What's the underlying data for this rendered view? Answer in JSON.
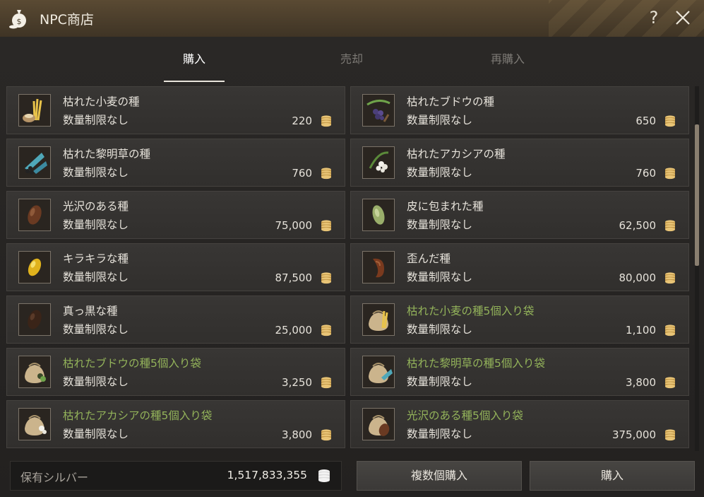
{
  "window": {
    "title": "NPC商店"
  },
  "tabs": [
    {
      "label": "購入",
      "active": true
    },
    {
      "label": "売却",
      "active": false
    },
    {
      "label": "再購入",
      "active": false
    }
  ],
  "items": [
    {
      "name": "枯れた小麦の種",
      "limit": "数量制限なし",
      "price": "220",
      "bundle": false,
      "icon": "wheat-seed-icon"
    },
    {
      "name": "枯れたブドウの種",
      "limit": "数量制限なし",
      "price": "650",
      "bundle": false,
      "icon": "grape-seed-icon"
    },
    {
      "name": "枯れた黎明草の種",
      "limit": "数量制限なし",
      "price": "760",
      "bundle": false,
      "icon": "dawn-grass-seed-icon"
    },
    {
      "name": "枯れたアカシアの種",
      "limit": "数量制限なし",
      "price": "760",
      "bundle": false,
      "icon": "acacia-seed-icon"
    },
    {
      "name": "光沢のある種",
      "limit": "数量制限なし",
      "price": "75,000",
      "bundle": false,
      "icon": "glossy-seed-icon"
    },
    {
      "name": "皮に包まれた種",
      "limit": "数量制限なし",
      "price": "62,500",
      "bundle": false,
      "icon": "husked-seed-icon"
    },
    {
      "name": "キラキラな種",
      "limit": "数量制限なし",
      "price": "87,500",
      "bundle": false,
      "icon": "sparkly-seed-icon"
    },
    {
      "name": "歪んだ種",
      "limit": "数量制限なし",
      "price": "80,000",
      "bundle": false,
      "icon": "warped-seed-icon"
    },
    {
      "name": "真っ黒な種",
      "limit": "数量制限なし",
      "price": "25,000",
      "bundle": false,
      "icon": "black-seed-icon"
    },
    {
      "name": "枯れた小麦の種5個入り袋",
      "limit": "数量制限なし",
      "price": "1,100",
      "bundle": true,
      "icon": "wheat-seed-bag-icon"
    },
    {
      "name": "枯れたブドウの種5個入り袋",
      "limit": "数量制限なし",
      "price": "3,250",
      "bundle": true,
      "icon": "grape-seed-bag-icon"
    },
    {
      "name": "枯れた黎明草の種5個入り袋",
      "limit": "数量制限なし",
      "price": "3,800",
      "bundle": true,
      "icon": "dawn-grass-seed-bag-icon"
    },
    {
      "name": "枯れたアカシアの種5個入り袋",
      "limit": "数量制限なし",
      "price": "3,800",
      "bundle": true,
      "icon": "acacia-seed-bag-icon"
    },
    {
      "name": "光沢のある種5個入り袋",
      "limit": "数量制限なし",
      "price": "375,000",
      "bundle": true,
      "icon": "glossy-seed-bag-icon"
    }
  ],
  "footer": {
    "silver_label": "保有シルバー",
    "silver_amount": "1,517,833,355",
    "multi_buy_label": "複数個購入",
    "buy_label": "購入"
  },
  "colors": {
    "bundle_name": "#93b35a",
    "coin": "#d9b25e",
    "titlebar": "#4d402d"
  }
}
